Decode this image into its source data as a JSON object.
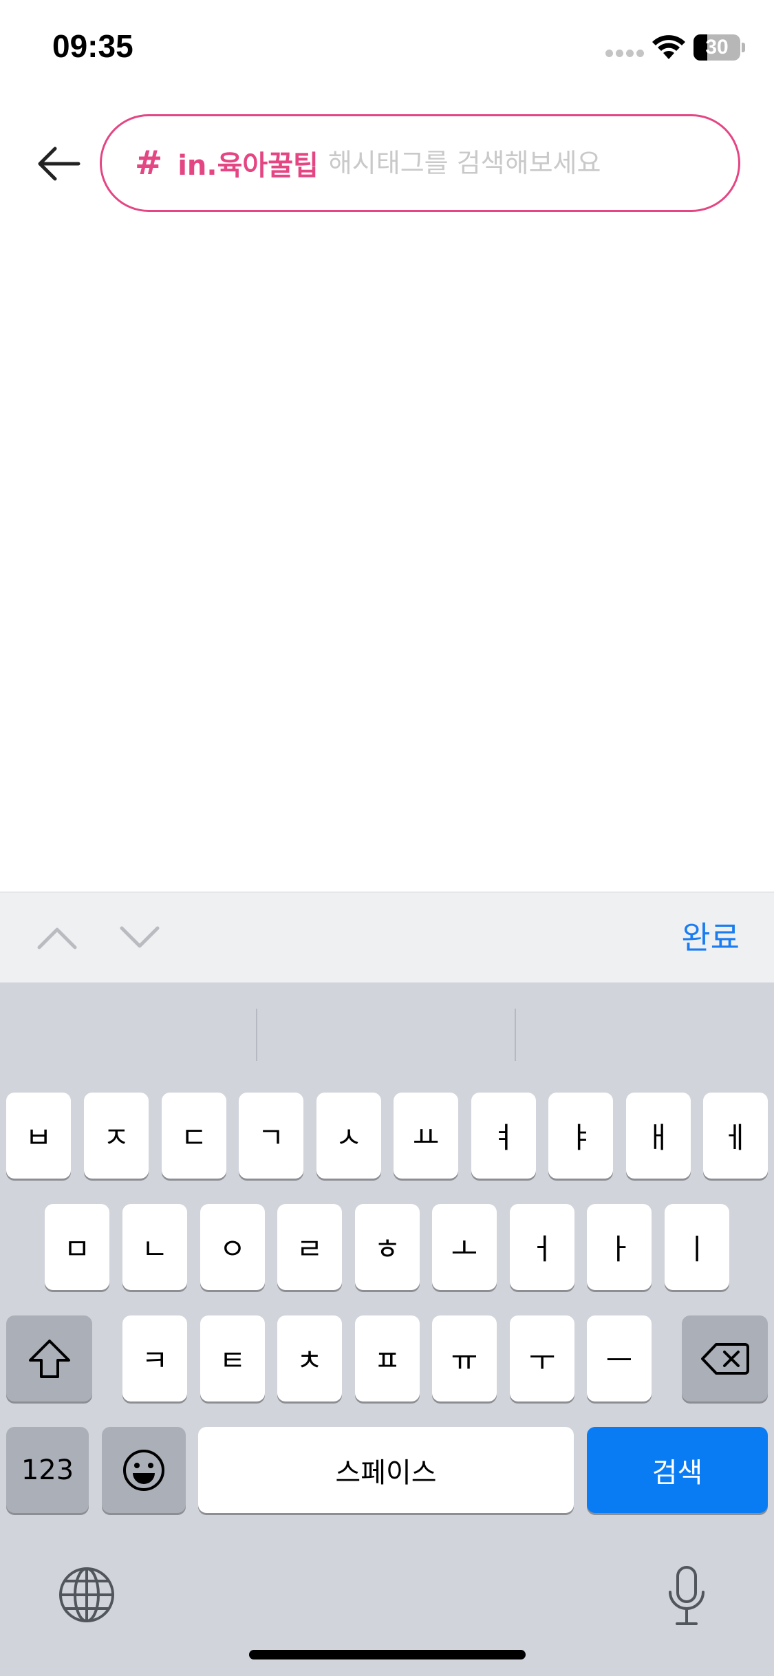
{
  "status_bar": {
    "time": "09:35",
    "battery_level": "30",
    "battery_fraction": 0.3
  },
  "search": {
    "hash_symbol": "#",
    "tag_prefix": "in.육아꿀팁",
    "placeholder": "해시태그를 검색해보세요",
    "value": "",
    "accent_color": "#e44683"
  },
  "accessory": {
    "done_label": "완료"
  },
  "keyboard": {
    "row1": [
      "ㅂ",
      "ㅈ",
      "ㄷ",
      "ㄱ",
      "ㅅ",
      "ㅛ",
      "ㅕ",
      "ㅑ",
      "ㅐ",
      "ㅔ"
    ],
    "row2": [
      "ㅁ",
      "ㄴ",
      "ㅇ",
      "ㄹ",
      "ㅎ",
      "ㅗ",
      "ㅓ",
      "ㅏ",
      "ㅣ"
    ],
    "row3": [
      "ㅋ",
      "ㅌ",
      "ㅊ",
      "ㅍ",
      "ㅠ",
      "ㅜ",
      "ㅡ"
    ],
    "numbers_label": "123",
    "space_label": "스페이스",
    "search_label": "검색",
    "search_color": "#0a7cf3"
  },
  "icons": {
    "back": "arrow-left-icon",
    "prev": "chevron-up-icon",
    "next": "chevron-down-icon",
    "shift": "shift-icon",
    "delete": "backspace-icon",
    "emoji": "emoji-icon",
    "globe": "globe-icon",
    "mic": "microphone-icon"
  }
}
